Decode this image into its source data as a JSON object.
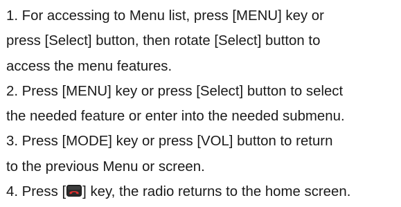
{
  "document": {
    "lines": [
      "1. For accessing to Menu list, press [MENU] key or",
      "press [Select] button, then rotate [Select] button to",
      "access the menu features.",
      "2. Press [MENU] key or press [Select] button to select",
      "the needed feature or enter into the needed submenu.",
      "3. Press [MODE] key or press [VOL] button to return",
      "to the previous Menu or screen."
    ],
    "last_line": {
      "before_icon": "4. Press [",
      "icon": "end-call-key-icon",
      "after_icon": "] key, the radio returns to the home screen."
    }
  },
  "colors": {
    "text": "#1a1a1a",
    "key_background": "#2b2b2b",
    "handset": "#e03030"
  }
}
